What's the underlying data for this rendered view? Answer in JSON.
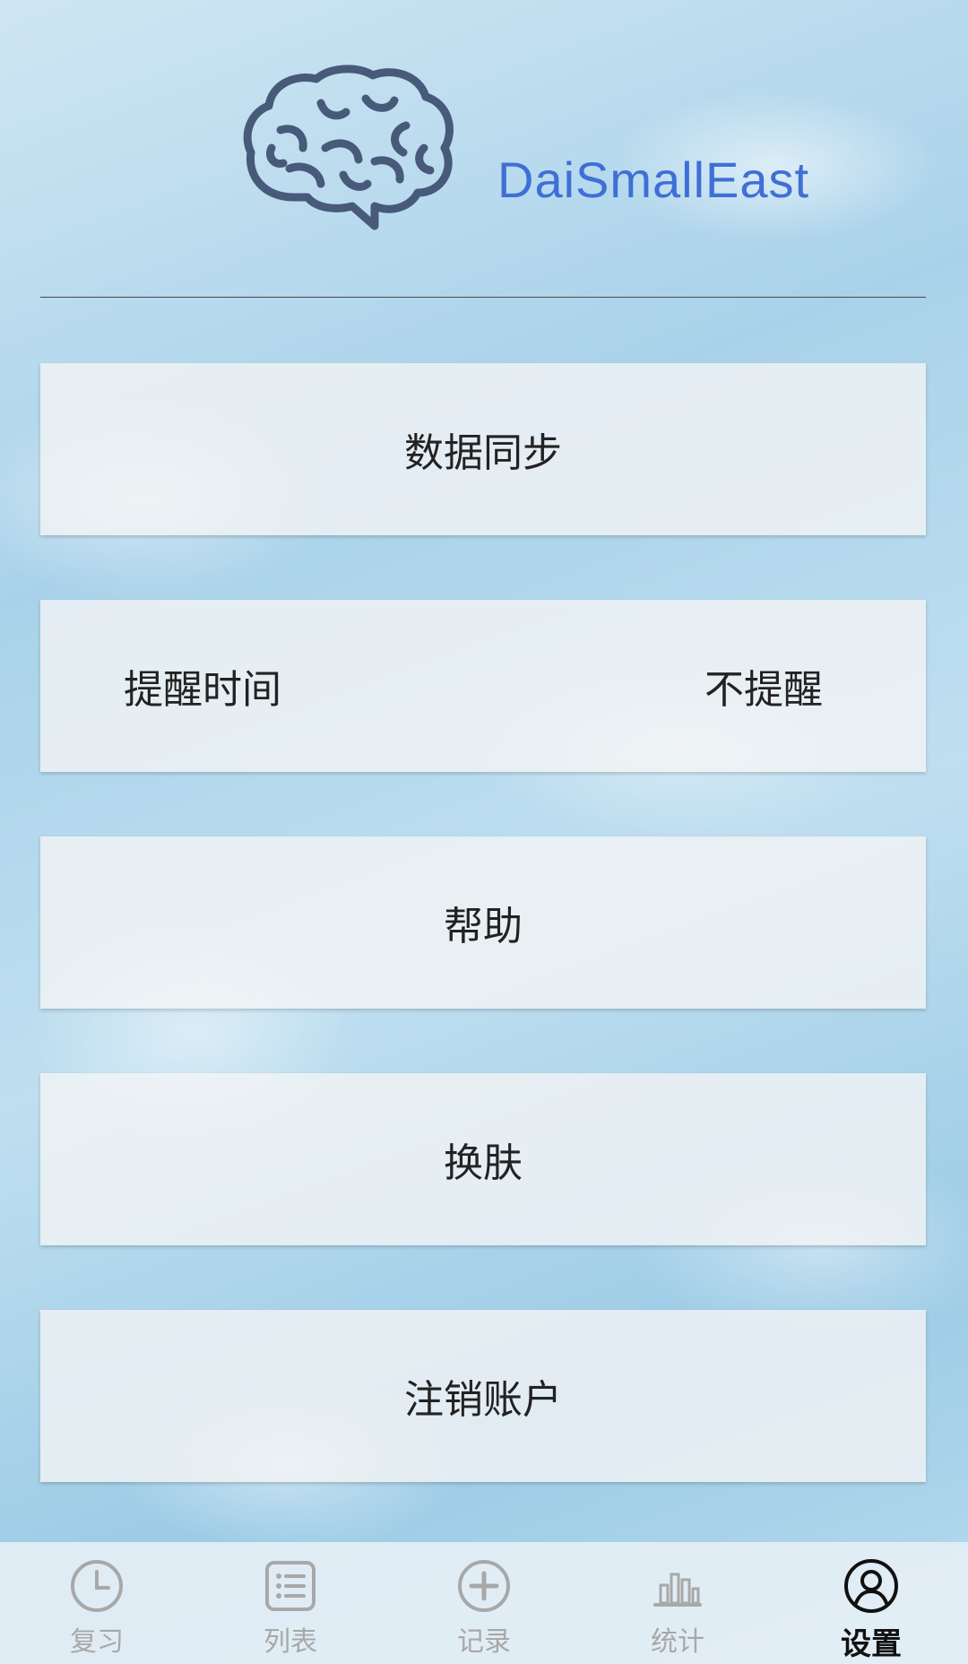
{
  "header": {
    "app_name": "DaiSmallEast",
    "logo_icon": "brain-icon",
    "accent_color": "#3f6fd6"
  },
  "menu": {
    "sync_label": "数据同步",
    "reminder_label": "提醒时间",
    "reminder_value": "不提醒",
    "help_label": "帮助",
    "skin_label": "换肤",
    "logout_label": "注销账户"
  },
  "tabbar": {
    "items": [
      {
        "label": "复习",
        "icon": "clock-icon",
        "active": false
      },
      {
        "label": "列表",
        "icon": "list-icon",
        "active": false
      },
      {
        "label": "记录",
        "icon": "plus-circle-icon",
        "active": false
      },
      {
        "label": "统计",
        "icon": "bar-chart-icon",
        "active": false
      },
      {
        "label": "设置",
        "icon": "user-circle-icon",
        "active": true
      }
    ]
  }
}
